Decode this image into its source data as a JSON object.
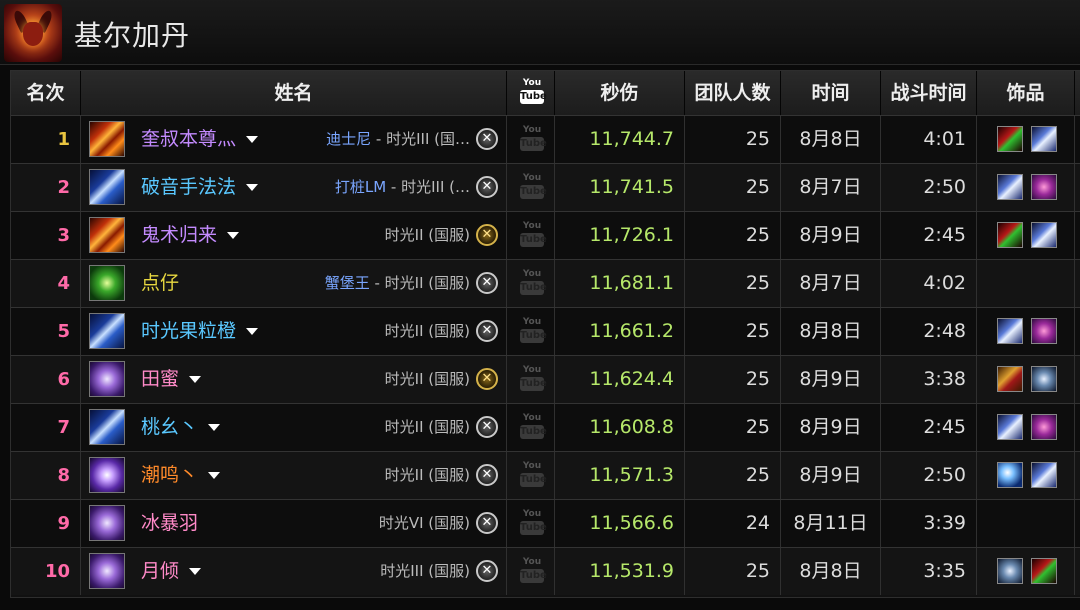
{
  "title": "基尔加丹",
  "headers": {
    "rank": "名次",
    "name": "姓名",
    "video_top": "You",
    "video_bottom": "Tube",
    "dps": "秒伤",
    "raid_size": "团队人数",
    "date": "时间",
    "fight_time": "战斗时间",
    "trinkets": "饰品"
  },
  "rows": [
    {
      "rank": "1",
      "rank_color": "#e8c440",
      "icon": "fire",
      "name": "奎叔本尊灬",
      "name_color": "#c48bff",
      "caret": true,
      "guild": "迪士尼",
      "realm": " - 时光III (国…",
      "faction": "neutral",
      "dps": "11,744.7",
      "raid": "25",
      "date": "8月8日",
      "time": "4:01",
      "trinkets": [
        "red",
        "blue"
      ]
    },
    {
      "rank": "2",
      "rank_color": "#ff6aa8",
      "icon": "frost",
      "name": "破音手法法",
      "name_color": "#5ac8ff",
      "caret": true,
      "guild": "打桩LM",
      "realm": " - 时光III (…",
      "faction": "neutral",
      "dps": "11,741.5",
      "raid": "25",
      "date": "8月7日",
      "time": "2:50",
      "trinkets": [
        "blue",
        "purple"
      ]
    },
    {
      "rank": "3",
      "rank_color": "#ff6aa8",
      "icon": "fire",
      "name": "鬼术归来",
      "name_color": "#c48bff",
      "caret": true,
      "guild": "",
      "realm": "时光II (国服)",
      "faction": "gold",
      "dps": "11,726.1",
      "raid": "25",
      "date": "8月9日",
      "time": "2:45",
      "trinkets": [
        "red",
        "blue"
      ]
    },
    {
      "rank": "4",
      "rank_color": "#ff6aa8",
      "icon": "nature",
      "name": "点仔",
      "name_color": "#e8d840",
      "caret": false,
      "guild": "蟹堡王",
      "realm": " - 时光II (国服)",
      "faction": "neutral",
      "dps": "11,681.1",
      "raid": "25",
      "date": "8月7日",
      "time": "4:02",
      "trinkets": []
    },
    {
      "rank": "5",
      "rank_color": "#ff6aa8",
      "icon": "frost",
      "name": "时光果粒橙",
      "name_color": "#5ac8ff",
      "caret": true,
      "guild": "",
      "realm": "时光II (国服)",
      "faction": "neutral",
      "dps": "11,661.2",
      "raid": "25",
      "date": "8月8日",
      "time": "2:48",
      "trinkets": [
        "blue",
        "purple"
      ]
    },
    {
      "rank": "6",
      "rank_color": "#ff6aa8",
      "icon": "hammer",
      "name": "田蜜",
      "name_color": "#ff8ac8",
      "caret": true,
      "guild": "",
      "realm": "时光II (国服)",
      "faction": "gold",
      "dps": "11,624.4",
      "raid": "25",
      "date": "8月9日",
      "time": "3:38",
      "trinkets": [
        "gold",
        "skull"
      ]
    },
    {
      "rank": "7",
      "rank_color": "#ff6aa8",
      "icon": "frost",
      "name": "桃幺丶",
      "name_color": "#5ac8ff",
      "caret": true,
      "guild": "",
      "realm": "时光II (国服)",
      "faction": "neutral",
      "dps": "11,608.8",
      "raid": "25",
      "date": "8月9日",
      "time": "2:45",
      "trinkets": [
        "blue",
        "purple"
      ]
    },
    {
      "rank": "8",
      "rank_color": "#ff6aa8",
      "icon": "arcane",
      "name": "潮鸣丶",
      "name_color": "#ff8a2a",
      "caret": true,
      "guild": "",
      "realm": "时光II (国服)",
      "faction": "neutral",
      "dps": "11,571.3",
      "raid": "25",
      "date": "8月9日",
      "time": "2:50",
      "trinkets": [
        "moon",
        "blue"
      ]
    },
    {
      "rank": "9",
      "rank_color": "#ff6aa8",
      "icon": "hammer",
      "name": "冰暴羽",
      "name_color": "#ff8ac8",
      "caret": false,
      "guild": "",
      "realm": "时光VI (国服)",
      "faction": "neutral",
      "dps": "11,566.6",
      "raid": "24",
      "date": "8月11日",
      "time": "3:39",
      "trinkets": []
    },
    {
      "rank": "10",
      "rank_color": "#ff6aa8",
      "icon": "hammer",
      "name": "月倾",
      "name_color": "#ff8ac8",
      "caret": true,
      "guild": "",
      "realm": "时光III (国服)",
      "faction": "neutral",
      "dps": "11,531.9",
      "raid": "25",
      "date": "8月8日",
      "time": "3:35",
      "trinkets": [
        "skull",
        "red"
      ]
    }
  ]
}
